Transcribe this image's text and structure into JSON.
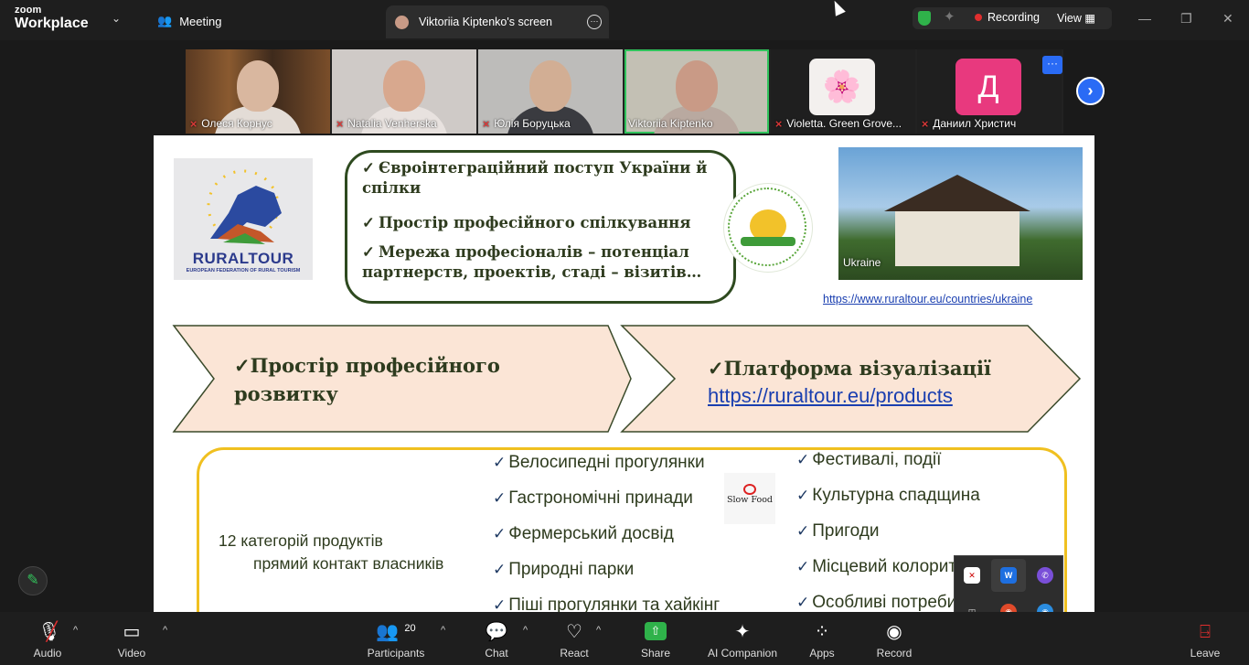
{
  "app": {
    "logo_line1": "zoom",
    "logo_line2": "Workplace",
    "meeting_label": "Meeting"
  },
  "share_tab": {
    "title": "Viktoriia Kiptenko's screen"
  },
  "status": {
    "recording_label": "Recording",
    "view_label": "View"
  },
  "participants": [
    {
      "name": "Олеся Корнус",
      "muted": true
    },
    {
      "name": "Natalia Venherska",
      "muted": true
    },
    {
      "name": "Юлія Боруцька",
      "muted": true
    },
    {
      "name": "Viktoriia Kiptenko",
      "muted": false,
      "active": true
    },
    {
      "name": "Violetta. Green Grove...",
      "muted": true,
      "avatar": "🌸"
    },
    {
      "name": "Даниил Христич",
      "muted": true,
      "avatar": "Д",
      "avatar_color": "#e8397e"
    }
  ],
  "slide": {
    "rural_logo": {
      "name": "RURALTOUR",
      "sub": "EUROPEAN FEDERATION OF RURAL TOURISM"
    },
    "bubble_items": [
      "Євроінтеграційний поступ України й спілки",
      "Простір професійного спілкування",
      "Мережа професіоналів – потенціал партнерств, проектів, стаді – візитів…"
    ],
    "photo_label": "Ukraine",
    "ukraine_link": "https://www.ruraltour.eu/countries/ukraine",
    "arrow1": [
      "✓Простір професійного",
      "розвитку"
    ],
    "arrow2_title": "✓Платформа візуалізації",
    "arrow2_link": "https://ruraltour.eu/products",
    "products_left": [
      "12 категорій продуктів",
      "прямий контакт власників"
    ],
    "col1": [
      "Велосипедні прогулянки",
      "Гастрономічні принади",
      "Фермерський досвід",
      "Природні парки",
      "Піші прогулянки та хайкінг"
    ],
    "col2": [
      "Фестивалі, події",
      "Культурна спадщина",
      "Пригоди",
      "Місцевий колорит",
      "Особливі потреби"
    ],
    "slowfood_label": "Slow Food"
  },
  "toolbar": {
    "audio": "Audio",
    "video": "Video",
    "participants": "Participants",
    "participants_count": "20",
    "chat": "Chat",
    "react": "React",
    "share": "Share",
    "ai": "AI Companion",
    "apps": "Apps",
    "record": "Record",
    "leave": "Leave"
  },
  "colors": {
    "accent": "#2a6bf5",
    "share_green": "#2fb24a",
    "recording_red": "#e02e2e",
    "slide_text": "#2e3b1e",
    "box_yellow": "#f0c020"
  }
}
